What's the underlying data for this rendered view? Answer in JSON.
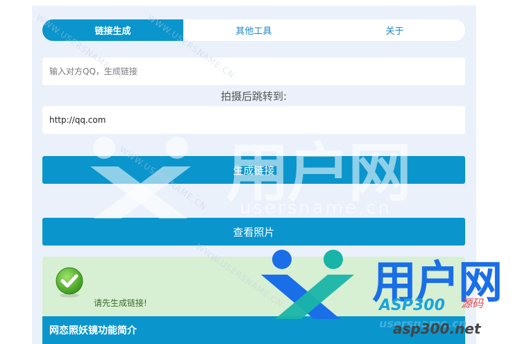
{
  "tabs": [
    {
      "label": "链接生成",
      "active": true
    },
    {
      "label": "其他工具",
      "active": false
    },
    {
      "label": "关于",
      "active": false
    }
  ],
  "qq_input": {
    "placeholder": "输入对方QQ，生成链接",
    "value": ""
  },
  "jump_label": "拍摄后跳转到:",
  "url_input": {
    "value": "http://qq.com"
  },
  "buttons": {
    "generate": "生成链接",
    "view_photos": "查看照片"
  },
  "status": {
    "text": "请先生成链接!"
  },
  "intro_header": "网恋照妖镜功能简介",
  "watermark": {
    "brand": "用户网",
    "domain": "usersname.cn",
    "repeat": "WWW.USERSNAME.CN",
    "logo_brand": "用户网",
    "logo_asp": "ASP300",
    "logo_usersname": "usersname.cn",
    "logo_site": "asp300.net",
    "logo_tag": "源码"
  },
  "colors": {
    "accent": "#0a95cc",
    "panel_bg": "#eaf1fb",
    "status_bg": "#d7efd2",
    "check": "#4caf2c"
  }
}
